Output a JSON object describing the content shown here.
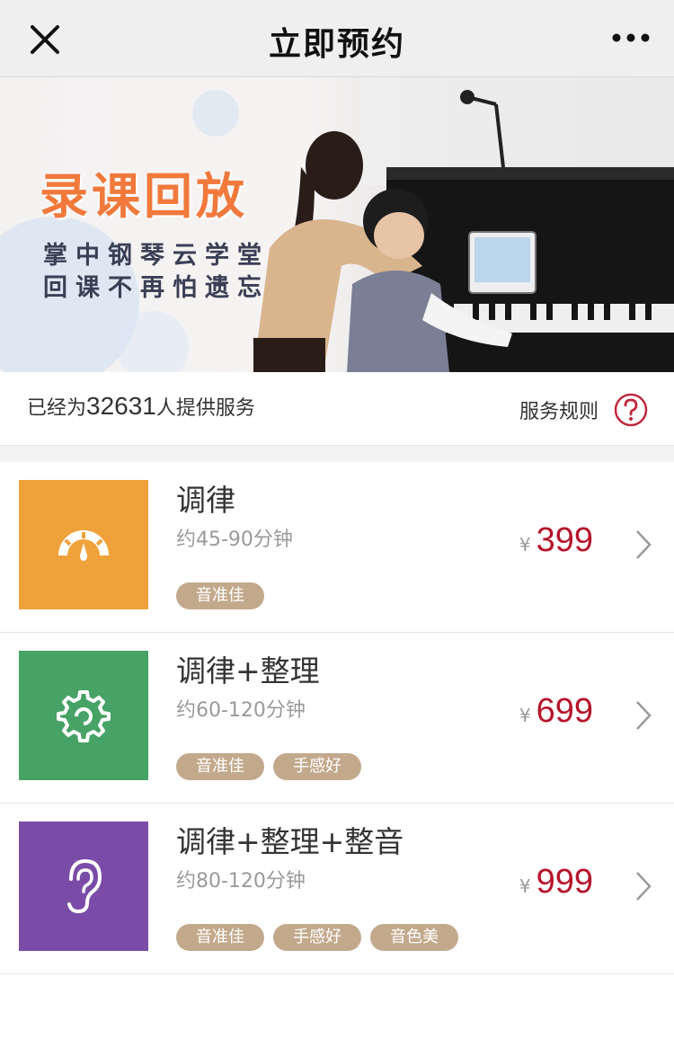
{
  "header": {
    "title": "立即预约",
    "close_icon": "close-icon",
    "more_icon": "more-dots-icon"
  },
  "banner": {
    "headline": "录课回放",
    "subline1": "掌中钢琴云学堂",
    "subline2": "回课不再怕遗忘",
    "headline_color": "#f0793b"
  },
  "info": {
    "prefix": "已经为",
    "count": "32631",
    "suffix": "人提供服务",
    "rules_label": "服务规则",
    "help_icon": "question-circle-icon"
  },
  "services": [
    {
      "name": "调律",
      "duration": "约45-90分钟",
      "currency": "¥",
      "price": "399",
      "icon": "gauge-icon",
      "color": "#f0a23a",
      "tags": [
        "音准佳"
      ]
    },
    {
      "name": "调律+整理",
      "duration": "约60-120分钟",
      "currency": "¥",
      "price": "699",
      "icon": "gear-icon",
      "color": "#47a265",
      "tags": [
        "音准佳",
        "手感好"
      ]
    },
    {
      "name": "调律+整理+整音",
      "duration": "约80-120分钟",
      "currency": "¥",
      "price": "999",
      "icon": "ear-icon",
      "color": "#7a4ca8",
      "tags": [
        "音准佳",
        "手感好",
        "音色美"
      ]
    }
  ],
  "colors": {
    "price": "#b5152b",
    "tag_bg": "#c3a98c",
    "help_icon": "#c0283d"
  }
}
